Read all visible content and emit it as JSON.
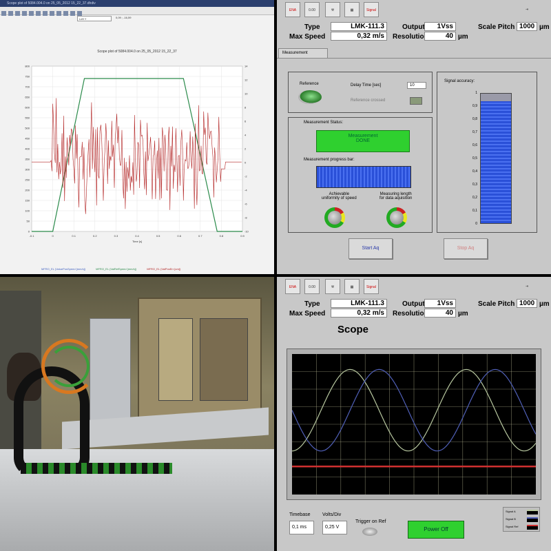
{
  "q1": {
    "window_title": "Scope plot of 5084.004.0 on 25_05_2012 15_22_37.dhdiv",
    "selector_value": "Left Y",
    "coord_value": "0,09 ; -16,59",
    "plot_title": "Scope plot of 5084.004.0 on 25_05_2012 15_22_37",
    "y_ticks": [
      "800",
      "750",
      "700",
      "650",
      "600",
      "550",
      "500",
      "450",
      "400",
      "350",
      "300",
      "250",
      "200",
      "150",
      "100",
      "50",
      "0"
    ],
    "y2_ticks": [
      "14",
      "12",
      "10",
      "8",
      "6",
      "4",
      "2",
      "0",
      "-2",
      "-4",
      "-6",
      "-8",
      "-10"
    ],
    "x_ticks": [
      "-0.1",
      "0",
      "0.1",
      "0.2",
      "0.3",
      "0.4",
      "0.5",
      "0.6",
      "0.7",
      "0.8",
      "0.9"
    ],
    "x_label": "Time [s]",
    "legend": [
      "MFRO_EL (ValuePosSpeed [mm/s])",
      "MFRO_EL (ValRefSpeed [mm/s])",
      "MFRO_EL (ValPosErr [um])"
    ],
    "colors": {
      "blue": "#4060c0",
      "green": "#2a8a4a",
      "red": "#b22222"
    }
  },
  "header": {
    "toolbar": [
      "ENA",
      "0.00",
      "tools",
      "scope",
      "Signal"
    ],
    "type_label": "Type",
    "type_value": "LMK-111.3",
    "speed_label": "Max Speed",
    "speed_value": "0,32 m/s",
    "output_label": "Output",
    "output_value": "1Vss",
    "resolution_label": "Resolution",
    "resolution_value": "40",
    "resolution_unit": "µm",
    "pitch_label": "Scale Pitch",
    "pitch_value": "1000",
    "pitch_unit": "µm"
  },
  "measurement": {
    "tab": "Measurement",
    "reference_label": "Reference",
    "delay_label": "Delay Time [sec]",
    "delay_value": "10",
    "ref_crossed_label": "Reference crossed",
    "status_label": "Measurement Status:",
    "status_line1": "Measurement",
    "status_line2": "DONE",
    "progress_label": "Measurement progress bar:",
    "progress_value": 1.0,
    "uniformity_label_1": "Achievable",
    "uniformity_label_2": "uniformity of speed",
    "length_label_1": "Measuring length",
    "length_label_2": "for data aquisition",
    "accuracy_label": "Signal accuracy:",
    "accuracy_ticks": [
      "1",
      "0,9",
      "0,8",
      "0,7",
      "0,6",
      "0,5",
      "0,4",
      "0,3",
      "0,2",
      "0,1",
      "0"
    ],
    "accuracy_value": 0.94,
    "start_button": "Start Aq",
    "stop_button": "Stop Aq"
  },
  "scope": {
    "title": "Scope",
    "timebase_label": "Timebase",
    "timebase_value": "0,1 ms",
    "volts_label": "Volts/Div",
    "volts_value": "0,25 V",
    "trigger_label": "Trigger on Ref",
    "power_button": "Power Off",
    "legend": [
      "Signal A",
      "Signal B",
      "Signal Ref"
    ],
    "colors": {
      "signal_a": "#b8c8a0",
      "signal_b": "#5060b8",
      "signal_ref": "#d03030",
      "grid": "#c8c8a0"
    }
  }
}
